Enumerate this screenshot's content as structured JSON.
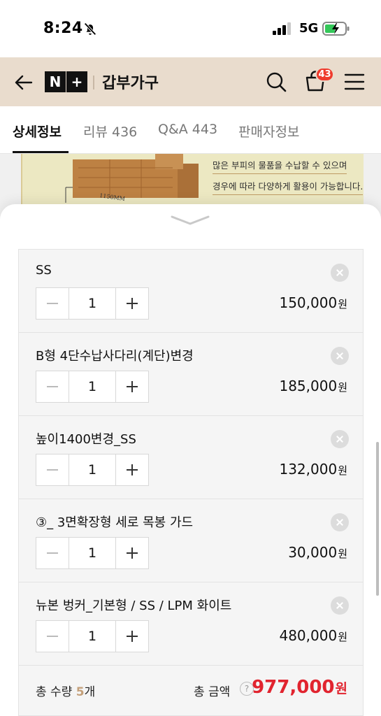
{
  "status_bar": {
    "time": "8:24",
    "network": "5G"
  },
  "header": {
    "store_name": "갑부가구",
    "cart_count": "43",
    "logo_left": "N",
    "logo_right": "+"
  },
  "tabs": [
    {
      "label": "상세정보"
    },
    {
      "label": "리뷰 436"
    },
    {
      "label": "Q&A 443"
    },
    {
      "label": "판매자정보"
    }
  ],
  "detail_peek": {
    "line1": "많은 부피의 물품을 수납할 수 있으며",
    "line2": "경우에 따라 다양하게 활용이 가능합니다.",
    "dimension": "1150MM"
  },
  "options": [
    {
      "name": "SS",
      "qty": "1",
      "price": "150,000"
    },
    {
      "name": "B형 4단수납사다리(계단)변경",
      "qty": "1",
      "price": "185,000"
    },
    {
      "name": "높이1400변경_SS",
      "qty": "1",
      "price": "132,000"
    },
    {
      "name": "③_ 3면확장형 세로 목봉 가드",
      "qty": "1",
      "price": "30,000"
    },
    {
      "name": "뉴본 벙커_기본형 / SS / LPM 화이트",
      "qty": "1",
      "price": "480,000"
    }
  ],
  "currency": "원",
  "summary": {
    "qty_label": "총 수량",
    "qty_value": "5",
    "qty_unit": "개",
    "total_label": "총 금액",
    "help": "?",
    "total_price": "977,000"
  },
  "colors": {
    "header_bg": "#e9dccd",
    "badge": "#ef3b2d",
    "total_price": "#e1242f",
    "qty_accent": "#c4a07a"
  }
}
